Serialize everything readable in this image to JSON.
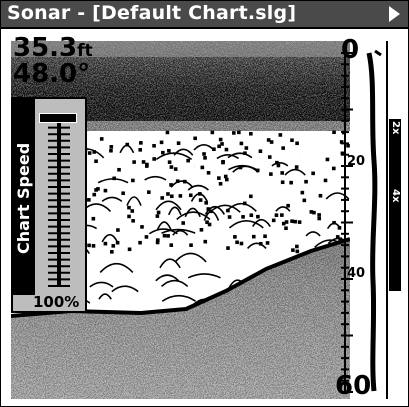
{
  "window": {
    "title": "Sonar - [Default Chart.slg]"
  },
  "readouts": {
    "depth_value": "35.3",
    "depth_unit": "ft",
    "temperature": "48.0°"
  },
  "depth_scale": {
    "top": "0",
    "mid1": "20",
    "mid2": "40",
    "bottom": "60"
  },
  "zoom_bar": {
    "label_1": "2x",
    "label_2": "4x"
  },
  "chart_speed": {
    "title": "Chart Speed",
    "value_text": "100%",
    "level": 1.0
  },
  "colors": {
    "titlebar": "#4a4a4a",
    "panel": "#bdbdbd"
  }
}
